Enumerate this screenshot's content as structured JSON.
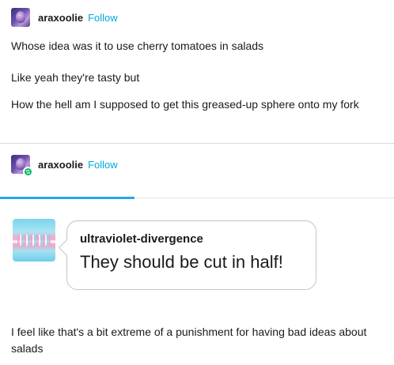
{
  "post": {
    "original": {
      "username": "araxoolie",
      "follow_label": "Follow",
      "paragraphs": [
        "Whose idea was it to use cherry tomatoes in salads",
        "Like yeah they're tasty but",
        "How the hell am I supposed to get this greased-up sphere onto my fork"
      ]
    },
    "reblog": {
      "username": "araxoolie",
      "follow_label": "Follow",
      "ask": {
        "asker": "ultraviolet-divergence",
        "question": "They should be cut in half!"
      },
      "answer": "I feel like that's a bit extreme of a punishment for having bad ideas about salads"
    }
  },
  "colors": {
    "follow_link": "#00a8e0",
    "reblog_badge": "#00b86b",
    "tab_accent": "#21a8e6"
  },
  "icons": {
    "reblog_badge": "reblog-icon"
  }
}
